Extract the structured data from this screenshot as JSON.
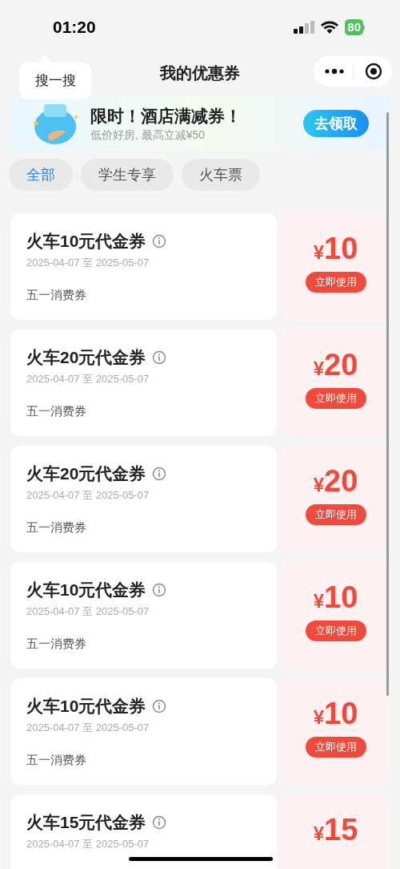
{
  "status_bar": {
    "time": "01:20",
    "battery": "80"
  },
  "tooltip": {
    "label": "搜一搜"
  },
  "nav": {
    "title": "我的优惠券"
  },
  "banner": {
    "title": "限时！酒店满减券！",
    "subtitle": "低价好房, 最高立减¥50",
    "button": "去领取"
  },
  "tabs": [
    {
      "label": "全部",
      "selected": true
    },
    {
      "label": "学生专享",
      "selected": false
    },
    {
      "label": "火车票",
      "selected": false
    }
  ],
  "coupons": [
    {
      "title": "火车10元代金券",
      "dates": "2025-04-07 至 2025-05-07",
      "tag": "五一消费券",
      "currency": "¥",
      "amount": "10",
      "button": "立即使用"
    },
    {
      "title": "火车20元代金券",
      "dates": "2025-04-07 至 2025-05-07",
      "tag": "五一消费券",
      "currency": "¥",
      "amount": "20",
      "button": "立即使用"
    },
    {
      "title": "火车20元代金券",
      "dates": "2025-04-07 至 2025-05-07",
      "tag": "五一消费券",
      "currency": "¥",
      "amount": "20",
      "button": "立即使用"
    },
    {
      "title": "火车10元代金券",
      "dates": "2025-04-07 至 2025-05-07",
      "tag": "五一消费券",
      "currency": "¥",
      "amount": "10",
      "button": "立即使用"
    },
    {
      "title": "火车10元代金券",
      "dates": "2025-04-07 至 2025-05-07",
      "tag": "五一消费券",
      "currency": "¥",
      "amount": "10",
      "button": "立即使用"
    },
    {
      "title": "火车15元代金券",
      "dates": "2025-04-07 至 2025-05-07",
      "currency": "¥",
      "amount": "15"
    }
  ]
}
